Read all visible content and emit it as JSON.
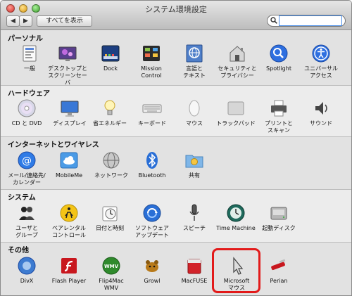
{
  "window": {
    "title": "システム環境設定"
  },
  "toolbar": {
    "back_label": "◀",
    "forward_label": "▶",
    "show_all_label": "すべてを表示"
  },
  "search": {
    "value": "",
    "placeholder": ""
  },
  "sections": {
    "personal": {
      "title": "パーソナル",
      "items": [
        {
          "label": "一般",
          "icon": "general-icon"
        },
        {
          "label": "デスクトップと\nスクリーンセーバ",
          "icon": "desktop-screensaver-icon"
        },
        {
          "label": "Dock",
          "icon": "dock-icon"
        },
        {
          "label": "Mission\nControl",
          "icon": "mission-control-icon"
        },
        {
          "label": "言語と\nテキスト",
          "icon": "language-text-icon"
        },
        {
          "label": "セキュリティと\nプライバシー",
          "icon": "security-privacy-icon"
        },
        {
          "label": "Spotlight",
          "icon": "spotlight-icon"
        },
        {
          "label": "ユニバーサル\nアクセス",
          "icon": "universal-access-icon"
        }
      ]
    },
    "hardware": {
      "title": "ハードウェア",
      "items": [
        {
          "label": "CD と DVD",
          "icon": "cd-dvd-icon"
        },
        {
          "label": "ディスプレイ",
          "icon": "display-icon"
        },
        {
          "label": "省エネルギー",
          "icon": "energy-saver-icon"
        },
        {
          "label": "キーボード",
          "icon": "keyboard-icon"
        },
        {
          "label": "マウス",
          "icon": "mouse-icon"
        },
        {
          "label": "トラックパッド",
          "icon": "trackpad-icon"
        },
        {
          "label": "プリントと\nスキャン",
          "icon": "printer-icon"
        },
        {
          "label": "サウンド",
          "icon": "sound-icon"
        }
      ]
    },
    "internet": {
      "title": "インターネットとワイヤレス",
      "items": [
        {
          "label": "メール/連絡先/\nカレンダー",
          "icon": "mail-contacts-calendar-icon"
        },
        {
          "label": "MobileMe",
          "icon": "mobileme-icon"
        },
        {
          "label": "ネットワーク",
          "icon": "network-icon"
        },
        {
          "label": "Bluetooth",
          "icon": "bluetooth-icon"
        },
        {
          "label": "共有",
          "icon": "sharing-icon"
        }
      ]
    },
    "system": {
      "title": "システム",
      "items": [
        {
          "label": "ユーザと\nグループ",
          "icon": "users-groups-icon"
        },
        {
          "label": "ペアレンタル\nコントロール",
          "icon": "parental-controls-icon"
        },
        {
          "label": "日付と時刻",
          "icon": "date-time-icon"
        },
        {
          "label": "ソフトウェア\nアップデート",
          "icon": "software-update-icon"
        },
        {
          "label": "スピーチ",
          "icon": "speech-icon"
        },
        {
          "label": "Time Machine",
          "icon": "time-machine-icon"
        },
        {
          "label": "起動ディスク",
          "icon": "startup-disk-icon"
        }
      ]
    },
    "other": {
      "title": "その他",
      "items": [
        {
          "label": "DivX",
          "icon": "divx-icon"
        },
        {
          "label": "Flash Player",
          "icon": "flash-player-icon"
        },
        {
          "label": "Flip4Mac\nWMV",
          "icon": "flip4mac-icon"
        },
        {
          "label": "Growl",
          "icon": "growl-icon"
        },
        {
          "label": "MacFUSE",
          "icon": "macfuse-icon"
        },
        {
          "label": "Microsoft\nマウス",
          "icon": "microsoft-mouse-icon"
        },
        {
          "label": "Perian",
          "icon": "perian-icon"
        }
      ]
    }
  },
  "highlight_color": "#e21a1a"
}
